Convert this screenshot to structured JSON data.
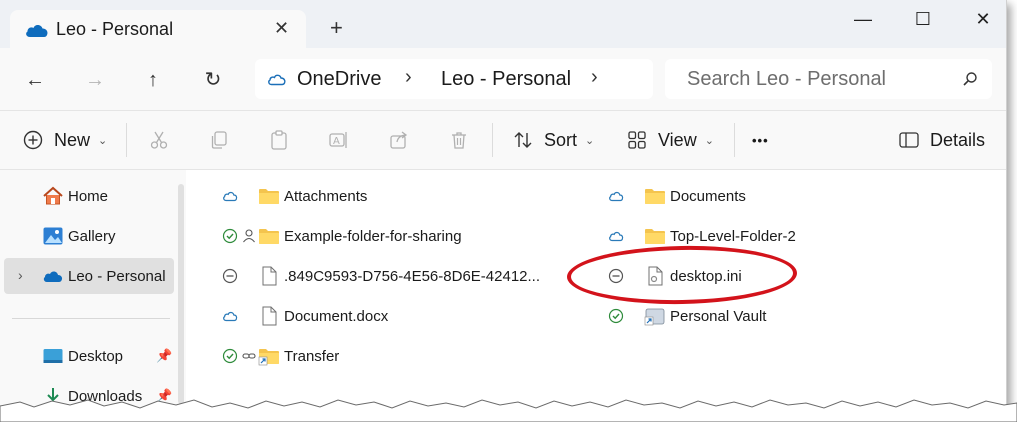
{
  "window": {
    "tab_title": "Leo - Personal",
    "tab_close": "✕",
    "new_tab": "+",
    "min": "—",
    "max": "☐",
    "close": "✕"
  },
  "nav": {
    "back": "←",
    "forward": "→",
    "up": "↑",
    "refresh": "↻",
    "breadcrumbs": [
      "OneDrive",
      "Leo - Personal"
    ],
    "crumb_sep": "›",
    "search_placeholder": "Search Leo - Personal"
  },
  "toolbar": {
    "new_label": "New",
    "sort_label": "Sort",
    "view_label": "View",
    "more_label": "•••",
    "details_label": "Details",
    "chevron": "⌄"
  },
  "sidebar": {
    "items": [
      {
        "label": "Home",
        "icon": "home-icon"
      },
      {
        "label": "Gallery",
        "icon": "gallery-icon"
      },
      {
        "label": "Leo - Personal",
        "icon": "onedrive-cloud-icon",
        "expand": "›",
        "selected": true
      },
      {
        "label": "Desktop",
        "icon": "desktop-folder-icon",
        "pin": "📌"
      },
      {
        "label": "Downloads",
        "icon": "downloads-icon",
        "pin": "📌"
      }
    ]
  },
  "files": {
    "left": [
      {
        "name": "Attachments",
        "status": "cloud",
        "type": "folder"
      },
      {
        "name": "Example-folder-for-sharing",
        "status": "synced-shared",
        "type": "folder"
      },
      {
        "name": ".849C9593-D756-4E56-8D6E-42412...",
        "status": "excluded",
        "type": "file"
      },
      {
        "name": "Document.docx",
        "status": "cloud",
        "type": "file"
      },
      {
        "name": "Transfer",
        "status": "synced-link",
        "type": "folder-shortcut"
      }
    ],
    "right": [
      {
        "name": "Documents",
        "status": "cloud",
        "type": "folder"
      },
      {
        "name": "Top-Level-Folder-2",
        "status": "cloud",
        "type": "folder"
      },
      {
        "name": "desktop.ini",
        "status": "excluded",
        "type": "settings-file"
      },
      {
        "name": "Personal Vault",
        "status": "synced",
        "type": "vault-shortcut"
      }
    ]
  },
  "colors": {
    "accent": "#0067c0",
    "folder": "#f4c44e",
    "cloud": "#2a7ab8",
    "synced": "#2e8b3b",
    "highlight_ring": "#d3131b"
  }
}
